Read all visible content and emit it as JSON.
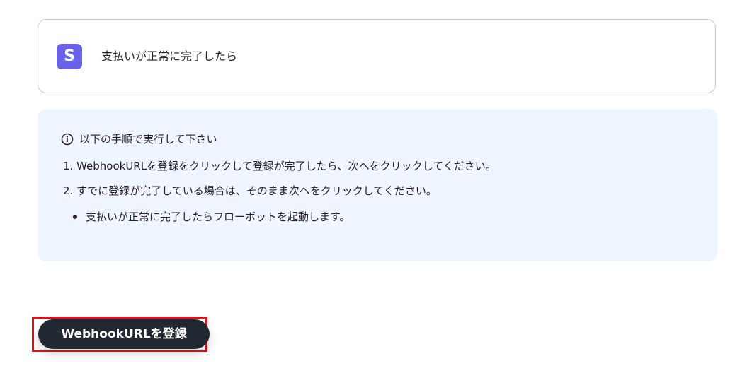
{
  "trigger": {
    "app_icon_letter": "S",
    "app_icon_color": "#6a62e8",
    "app_icon_name": "stripe-icon",
    "label": "支払いが正常に完了したら"
  },
  "info": {
    "heading": "以下の手順で実行して下さい",
    "icon_name": "info-icon",
    "steps": [
      "1. WebhookURLを登録をクリックして登録が完了したら、次へをクリックしてください。",
      "2. すでに登録が完了している場合は、そのまま次へをクリックしてください。"
    ],
    "note": "支払いが正常に完了したらフローボットを起動します。"
  },
  "actions": {
    "register_button_label": "WebhookURLを登録",
    "highlight_color": "#d9151f"
  },
  "colors": {
    "info_background": "#eef5ff",
    "button_background": "#222831"
  }
}
